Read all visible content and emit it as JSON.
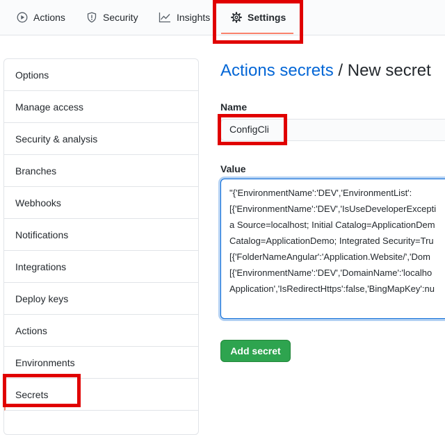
{
  "nav": {
    "tabs": [
      {
        "label": "Actions",
        "icon": "play-circle-icon"
      },
      {
        "label": "Security",
        "icon": "shield-icon"
      },
      {
        "label": "Insights",
        "icon": "graph-icon"
      },
      {
        "label": "Settings",
        "icon": "gear-icon"
      }
    ],
    "active_tab": "Settings",
    "highlight_color": "#e00000",
    "underline_color": "#f9826c"
  },
  "sidebar": {
    "items": [
      {
        "label": "Options"
      },
      {
        "label": "Manage access"
      },
      {
        "label": "Security & analysis"
      },
      {
        "label": "Branches"
      },
      {
        "label": "Webhooks"
      },
      {
        "label": "Notifications"
      },
      {
        "label": "Integrations"
      },
      {
        "label": "Deploy keys"
      },
      {
        "label": "Actions"
      },
      {
        "label": "Environments"
      },
      {
        "label": "Secrets"
      }
    ],
    "active_item": "Secrets"
  },
  "main": {
    "breadcrumb_link": "Actions secrets",
    "separator": "/",
    "title": "New secret",
    "name_label": "Name",
    "name_value": "ConfigCli",
    "value_label": "Value",
    "value_lines": [
      "\"{'EnvironmentName':'DEV','EnvironmentList':",
      "[{'EnvironmentName':'DEV','IsUseDeveloperExcepti",
      "a Source=localhost; Initial Catalog=ApplicationDem",
      "Catalog=ApplicationDemo; Integrated Security=Tru",
      "[{'FolderNameAngular':'Application.Website/','Dom",
      "[{'EnvironmentName':'DEV','DomainName':'localho",
      "Application','IsRedirectHttps':false,'BingMapKey':nu"
    ],
    "submit_label": "Add secret"
  },
  "colors": {
    "link": "#0366d6",
    "button": "#2ea44f",
    "annotation": "#e00000"
  }
}
